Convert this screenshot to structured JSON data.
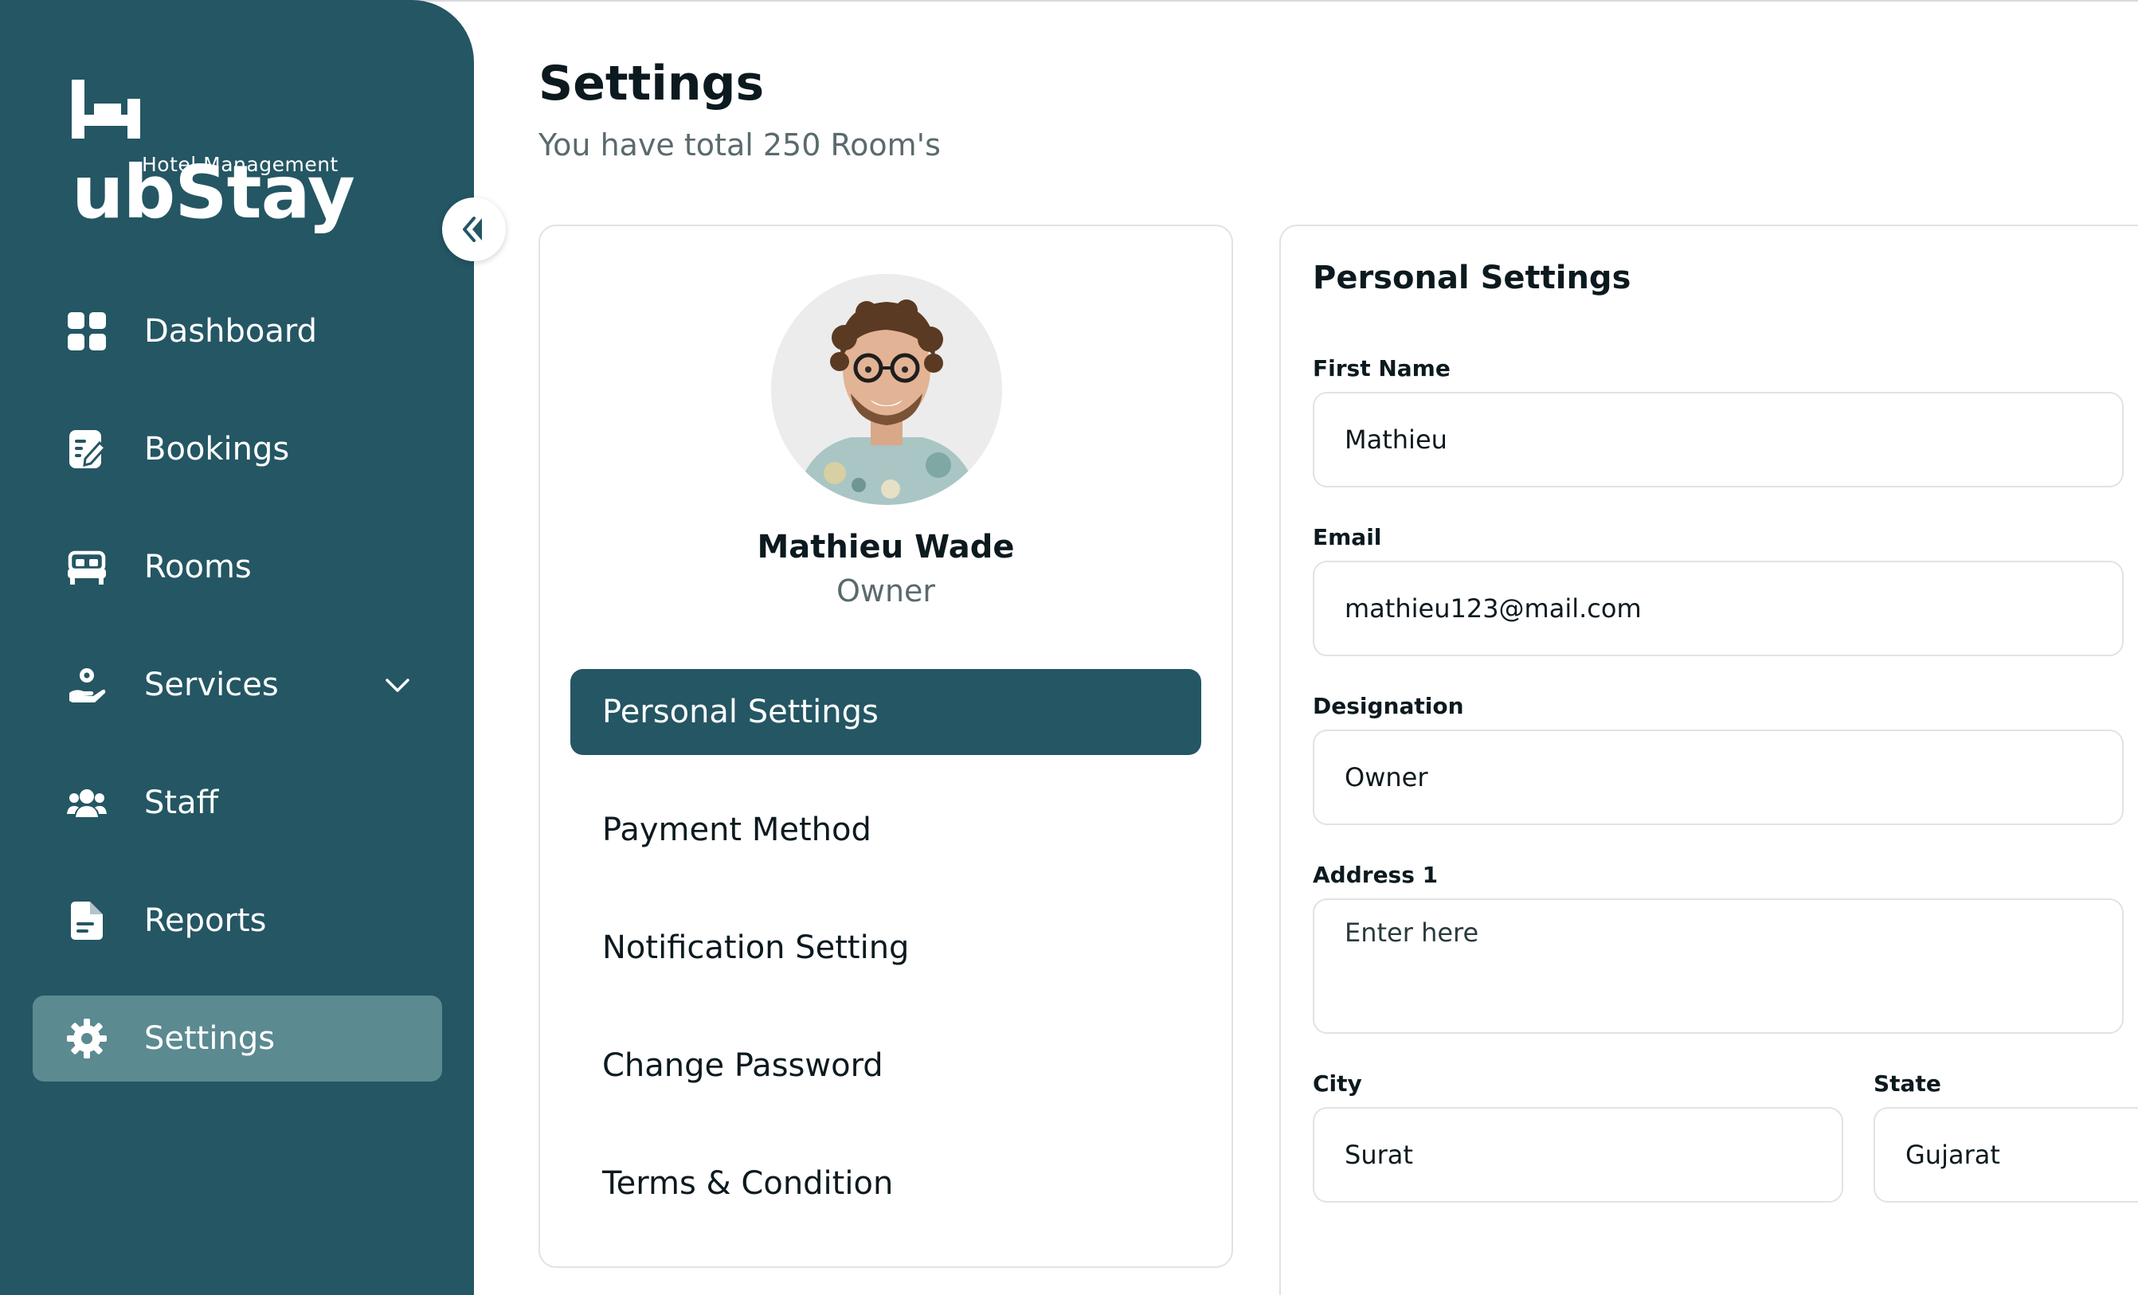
{
  "brand": {
    "name": "HubStay",
    "name_rest": "ubStay",
    "tagline": "Hotel Management"
  },
  "sidebar": {
    "items": [
      {
        "label": "Dashboard",
        "icon": "grid-icon"
      },
      {
        "label": "Bookings",
        "icon": "edit-note-icon"
      },
      {
        "label": "Rooms",
        "icon": "bed-icon"
      },
      {
        "label": "Services",
        "icon": "service-hand-icon"
      },
      {
        "label": "Staff",
        "icon": "team-icon"
      },
      {
        "label": "Reports",
        "icon": "document-icon"
      },
      {
        "label": "Settings",
        "icon": "gear-icon",
        "active": true
      }
    ]
  },
  "header": {
    "title": "Settings",
    "subtitle": "You have total 250 Room's"
  },
  "profile": {
    "name": "Mathieu Wade",
    "role": "Owner",
    "menu": [
      {
        "label": "Personal Settings",
        "active": true
      },
      {
        "label": "Payment Method"
      },
      {
        "label": "Notification Setting"
      },
      {
        "label": "Change Password"
      },
      {
        "label": "Terms & Condition"
      }
    ]
  },
  "form": {
    "title": "Personal Settings",
    "first_name_label": "First Name",
    "first_name_value": "Mathieu",
    "email_label": "Email",
    "email_value": "mathieu123@mail.com",
    "designation_label": "Designation",
    "designation_value": "Owner",
    "address_label": "Address 1",
    "address_placeholder": "Enter here",
    "city_label": "City",
    "city_value": "Surat",
    "state_label": "State",
    "state_value": "Gujarat"
  },
  "colors": {
    "sidebar_bg": "#245663",
    "active_nav_bg": "#5b8a91",
    "accent": "#245663",
    "border": "#dfe3e5"
  }
}
